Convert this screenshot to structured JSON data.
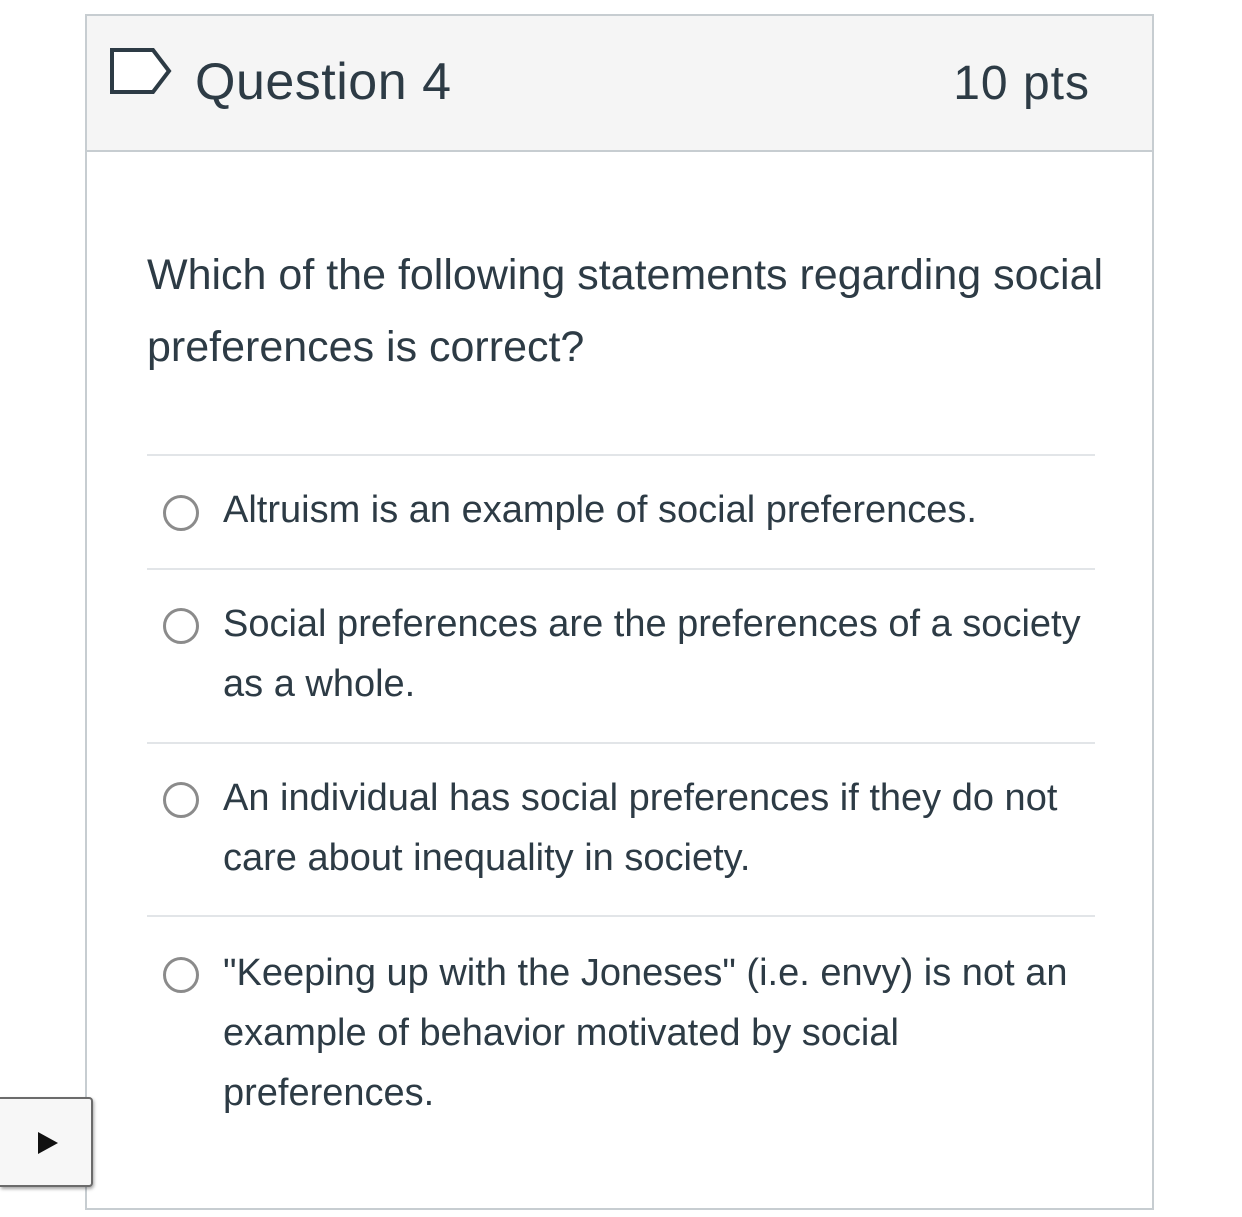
{
  "question": {
    "title": "Question 4",
    "points": "10 pts",
    "text": "Which of the following statements regarding social preferences is correct?"
  },
  "answers": [
    {
      "label": "Altruism is an example of social preferences.",
      "selected": false
    },
    {
      "label": "Social preferences are the preferences of a society as a whole.",
      "selected": false
    },
    {
      "label": "An individual has social preferences if they do not care about inequality in society.",
      "selected": false
    },
    {
      "label": "\"Keeping up with the Joneses\" (i.e. envy) is not an example of behavior motivated by social preferences.",
      "selected": false
    }
  ],
  "icons": {
    "flag": "flag-icon",
    "play": "play-icon"
  },
  "colors": {
    "text": "#2d3b45",
    "header_bg": "#f5f5f5",
    "border": "#c7cdd1",
    "radio_border": "#8b8b8b"
  }
}
